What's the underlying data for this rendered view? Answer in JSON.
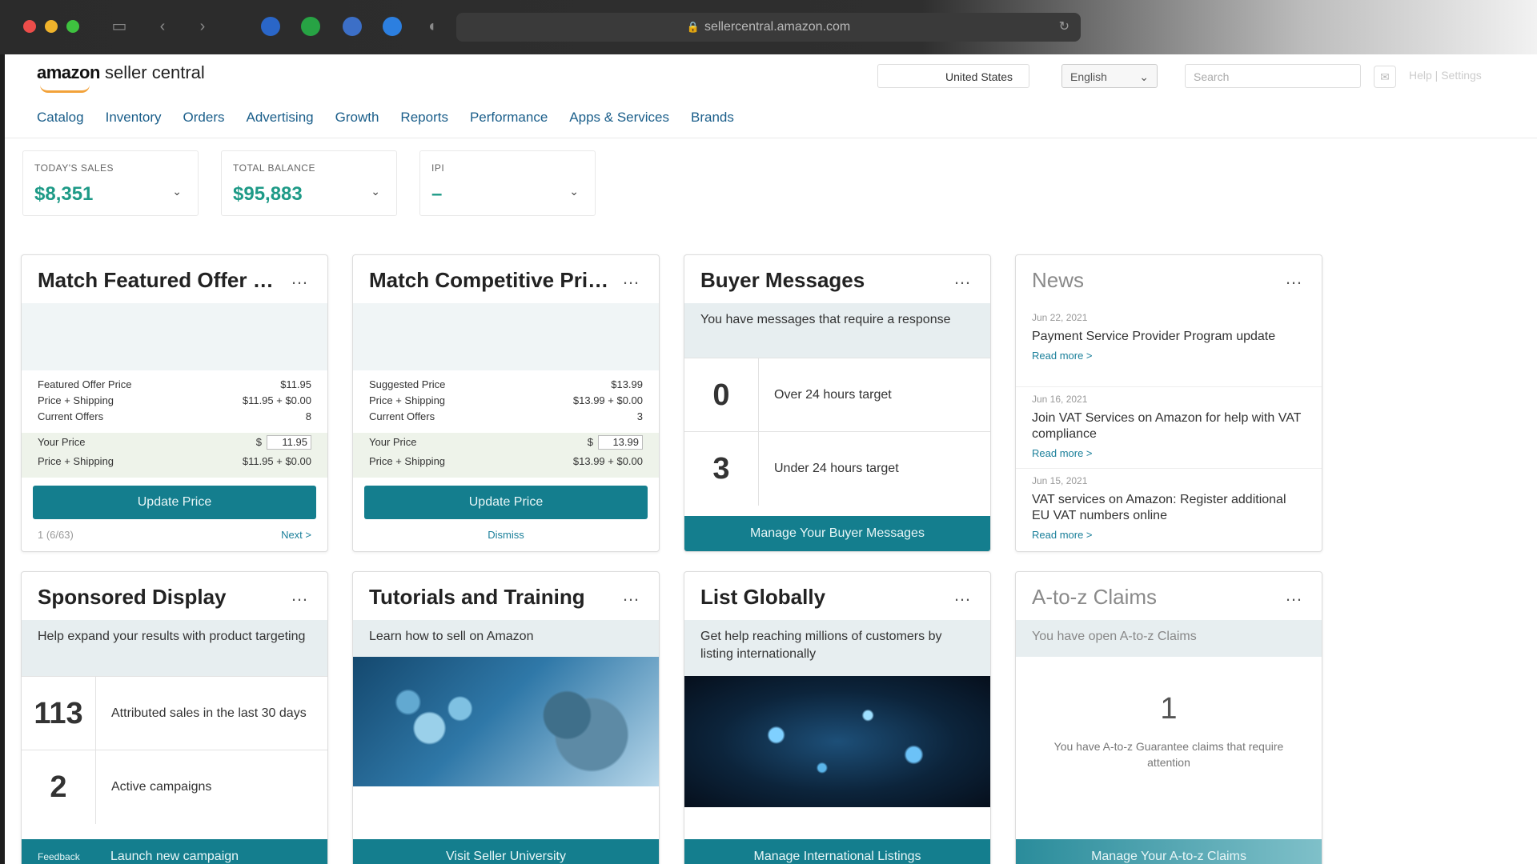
{
  "browser": {
    "url": "sellercentral.amazon.com"
  },
  "header": {
    "logo_word": "amazon",
    "logo_suffix": "seller central",
    "account": "United States",
    "language": "English",
    "search_placeholder": "Search",
    "help": "Help | Settings"
  },
  "nav": {
    "items": [
      "Catalog",
      "Inventory",
      "Orders",
      "Advertising",
      "Growth",
      "Reports",
      "Performance",
      "Apps & Services",
      "Brands"
    ]
  },
  "stats": [
    {
      "label": "TODAY'S SALES",
      "value": "$8,351"
    },
    {
      "label": "TOTAL BALANCE",
      "value": "$95,883"
    },
    {
      "label": "IPI",
      "value": "–"
    }
  ],
  "cards": {
    "featured_offer": {
      "title": "Match Featured Offer P...",
      "rows": [
        {
          "label": "Featured Offer Price",
          "value": "$11.95"
        },
        {
          "label": "Price + Shipping",
          "value": "$11.95 + $0.00"
        },
        {
          "label": "Current Offers",
          "value": "8"
        }
      ],
      "your_price_label": "Your Price",
      "your_price_currency": "$",
      "your_price_value": "11.95",
      "your_ship_label": "Price + Shipping",
      "your_ship_value": "$11.95 + $0.00",
      "button": "Update Price",
      "pager": "1 (6/63)",
      "next": "Next >"
    },
    "competitive_price": {
      "title": "Match Competitive Price",
      "rows": [
        {
          "label": "Suggested Price",
          "value": "$13.99"
        },
        {
          "label": "Price + Shipping",
          "value": "$13.99 + $0.00"
        },
        {
          "label": "Current Offers",
          "value": "3"
        }
      ],
      "your_price_label": "Your Price",
      "your_price_currency": "$",
      "your_price_value": "13.99",
      "your_ship_label": "Price + Shipping",
      "your_ship_value": "$13.99 + $0.00",
      "button": "Update Price",
      "dismiss": "Dismiss"
    },
    "buyer_messages": {
      "title": "Buyer Messages",
      "band": "You have messages that require a response",
      "rows": [
        {
          "num": "0",
          "text": "Over 24 hours target"
        },
        {
          "num": "3",
          "text": "Under 24 hours target"
        }
      ],
      "button": "Manage Your Buyer Messages"
    },
    "news": {
      "title": "News",
      "items": [
        {
          "date": "Jun 22, 2021",
          "text": "Payment Service Provider Program update",
          "more": "Read more >"
        },
        {
          "date": "Jun 16, 2021",
          "text": "Join VAT Services on Amazon for help with VAT compliance",
          "more": "Read more >"
        },
        {
          "date": "Jun 15, 2021",
          "text": "VAT services on Amazon: Register additional EU VAT numbers online",
          "more": "Read more >"
        }
      ]
    },
    "sponsored_display": {
      "title": "Sponsored Display",
      "band": "Help expand your results with product targeting",
      "rows": [
        {
          "num": "113",
          "text": "Attributed sales in the last 30 days"
        },
        {
          "num": "2",
          "text": "Active campaigns"
        }
      ],
      "feedback": "Feedback",
      "button": "Launch new campaign"
    },
    "tutorials": {
      "title": "Tutorials and Training",
      "band": "Learn how to sell on Amazon",
      "button": "Visit Seller University"
    },
    "list_globally": {
      "title": "List Globally",
      "band": "Get help reaching millions of customers by listing internationally",
      "button": "Manage International Listings"
    },
    "claims": {
      "title": "A-to-z Claims",
      "band": "You have open A-to-z Claims",
      "count": "1",
      "text": "You have A-to-z Guarantee claims that require attention",
      "button": "Manage Your A-to-z Claims"
    }
  }
}
